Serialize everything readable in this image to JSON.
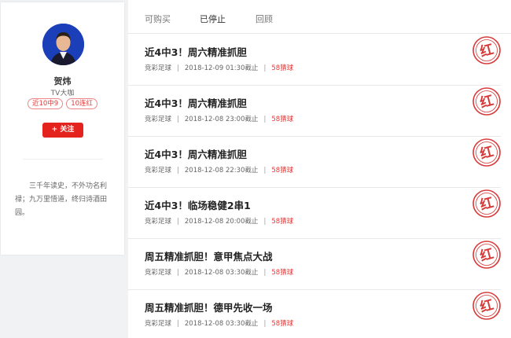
{
  "profile": {
    "name": "贺炜",
    "title": "TV大咖",
    "badges": [
      "近10中9",
      "10连红"
    ],
    "follow_label": "+ 关注",
    "bio": "三千年读史，不外功名利禄；九万里悟道，终归诗酒田园。"
  },
  "tabs": [
    {
      "label": "可购买",
      "active": false
    },
    {
      "label": "已停止",
      "active": true
    },
    {
      "label": "回顾",
      "active": false
    }
  ],
  "items": [
    {
      "title": "近4中3！周六精准抓胆",
      "category": "竞彩足球",
      "time": "2018-12-09 01:30截止",
      "price": "58猜球",
      "stamp": "红"
    },
    {
      "title": "近4中3！周六精准抓胆",
      "category": "竞彩足球",
      "time": "2018-12-08 23:00截止",
      "price": "58猜球",
      "stamp": "红"
    },
    {
      "title": "近4中3！周六精准抓胆",
      "category": "竞彩足球",
      "time": "2018-12-08 22:30截止",
      "price": "58猜球",
      "stamp": "红"
    },
    {
      "title": "近4中3！临场稳健2串1",
      "category": "竞彩足球",
      "time": "2018-12-08 20:00截止",
      "price": "58猜球",
      "stamp": "红"
    },
    {
      "title": "周五精准抓胆！意甲焦点大战",
      "category": "竞彩足球",
      "time": "2018-12-08 03:30截止",
      "price": "58猜球",
      "stamp": "红"
    },
    {
      "title": "周五精准抓胆！德甲先收一场",
      "category": "竞彩足球",
      "time": "2018-12-08 03:30截止",
      "price": "58猜球",
      "stamp": "红"
    }
  ],
  "colors": {
    "accent": "#e5231e",
    "stamp": "#d83a3a",
    "avatar_bg": "#1b3fb8"
  }
}
